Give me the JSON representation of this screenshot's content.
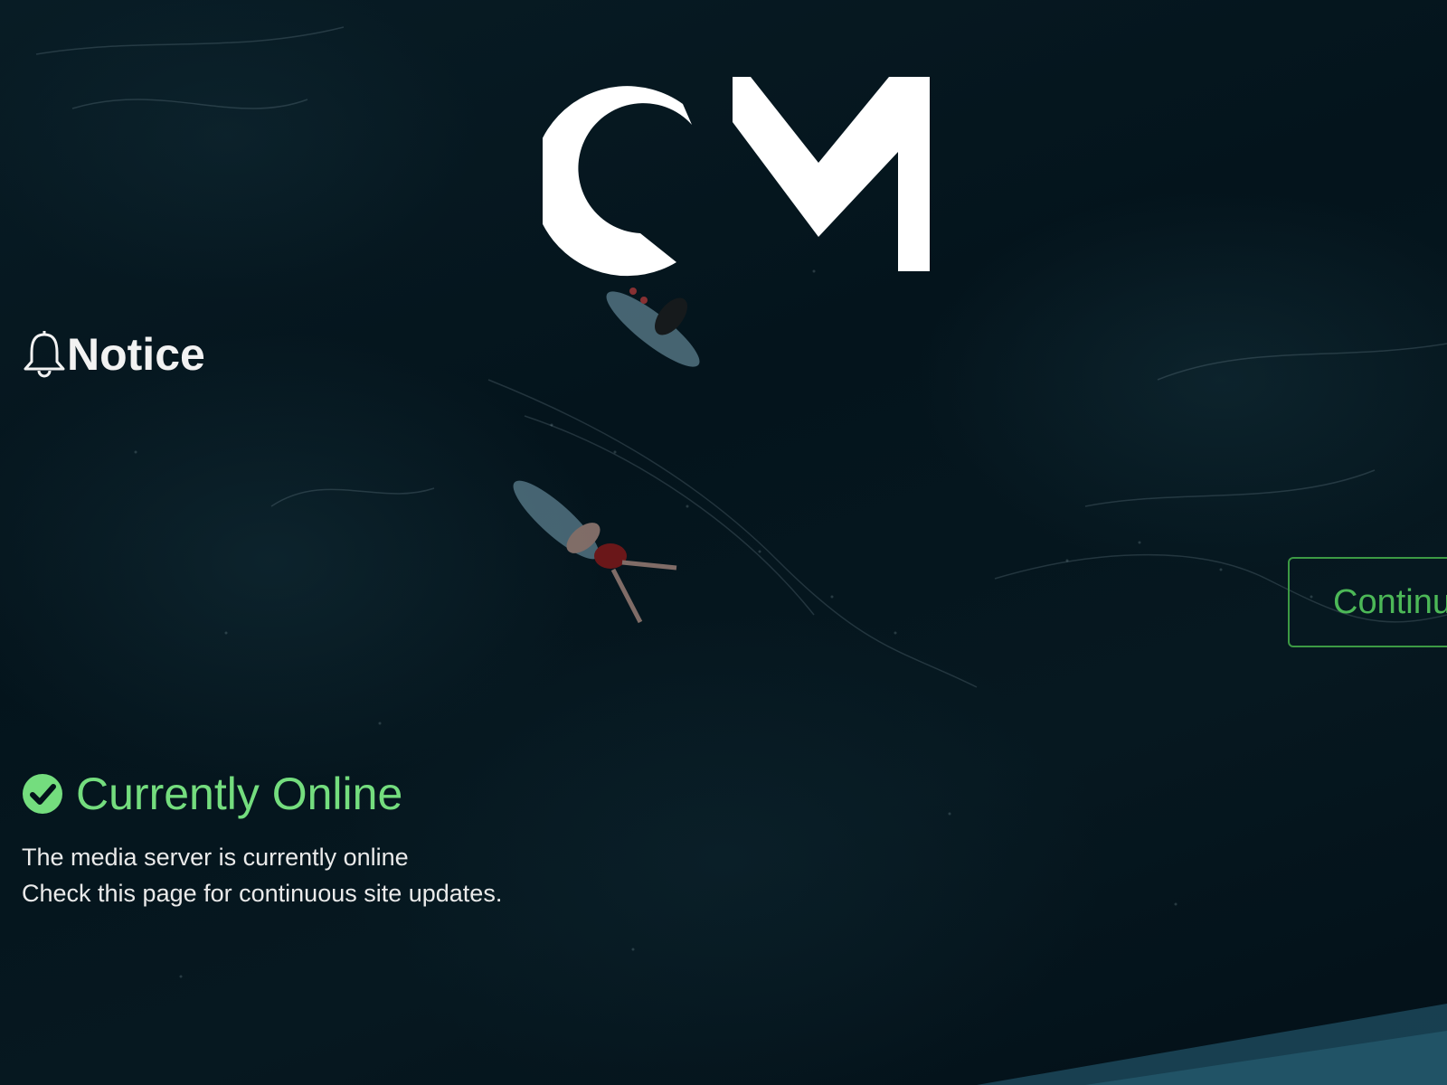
{
  "logo": {
    "text": "CM"
  },
  "notice": {
    "title": "Notice",
    "icon": "bell-icon"
  },
  "continue_button": {
    "label": "Continue"
  },
  "status": {
    "icon": "check-circle-icon",
    "title": "Currently Online",
    "lines": [
      "The media server is currently online",
      "Check this page for continuous site updates."
    ]
  },
  "colors": {
    "background": "#04121a",
    "status_green": "#74dd7e",
    "button_green": "#4cb857",
    "text": "#f2f2f2"
  }
}
